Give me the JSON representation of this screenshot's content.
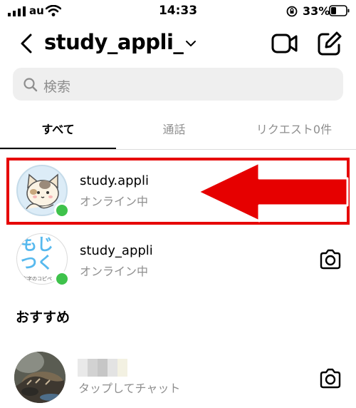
{
  "status_bar": {
    "carrier": "au",
    "time": "14:33",
    "battery": "33%"
  },
  "header": {
    "title": "study_appli_"
  },
  "search": {
    "placeholder": "検索"
  },
  "tabs": [
    {
      "label": "すべて",
      "active": true
    },
    {
      "label": "通話"
    },
    {
      "label": "リクエスト0件"
    }
  ],
  "conversations": [
    {
      "name": "study.appli",
      "status": "オンライン中",
      "highlighted": true
    },
    {
      "name": "study_appli",
      "status": "オンライン中"
    }
  ],
  "recommended": {
    "title": "おすすめ",
    "items": [
      {
        "name": "",
        "status": "タップしてチャット"
      }
    ]
  },
  "avatar_text": {
    "line1": "もじ",
    "line2": "つく",
    "tagline": "文字のコピペ"
  },
  "colors": {
    "accent_red": "#e60000",
    "online_green": "#3ec24b",
    "gray_text": "#8e8e8e"
  }
}
